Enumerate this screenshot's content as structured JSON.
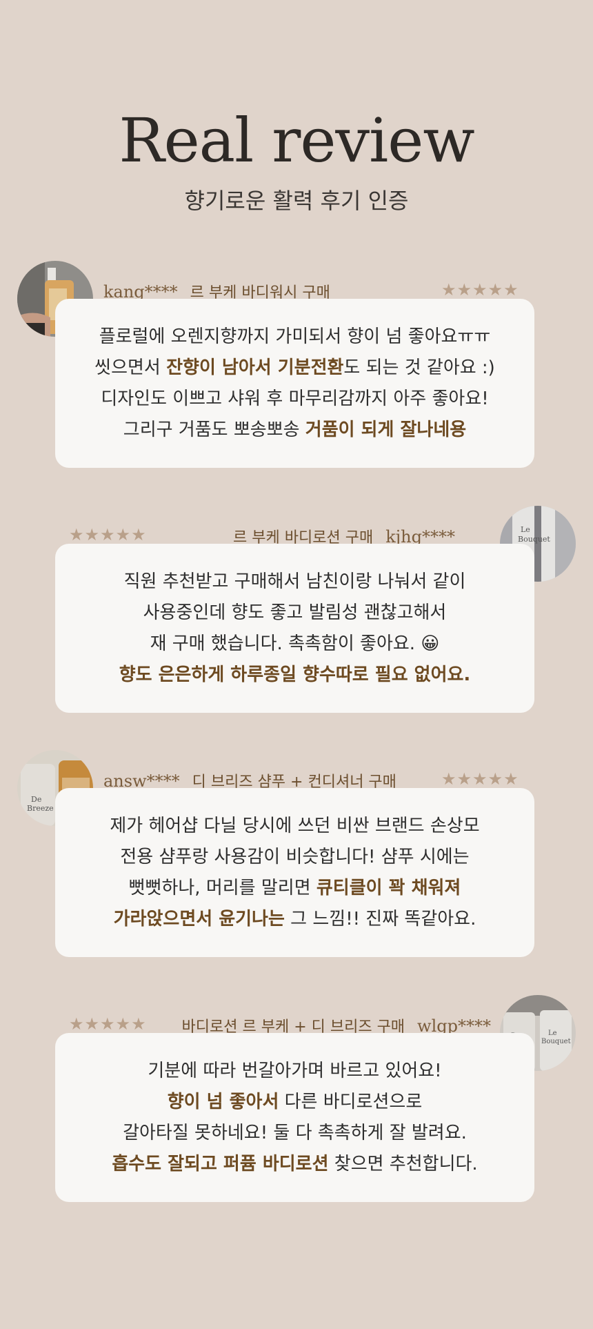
{
  "hero": {
    "title": "Real review",
    "subtitle": "향기로운 활력 후기 인증"
  },
  "rating_symbol": "★★★★★",
  "reviews": [
    {
      "user": "kang****",
      "product": "르 부케 바디워시 구매",
      "rating": 5,
      "avatar_icon": "body-wash-bottle-photo",
      "lines": [
        [
          {
            "t": "플로럴에 오렌지향까지 가미되서 향이 넘 좋아요ㅠㅠ",
            "h": false
          }
        ],
        [
          {
            "t": "씻으면서 ",
            "h": false
          },
          {
            "t": "잔향이 남아서 기분전환",
            "h": true
          },
          {
            "t": "도 되는 것 같아요 :)",
            "h": false
          }
        ],
        [
          {
            "t": "디자인도 이쁘고 샤워 후 마무리감까지 아주 좋아요!",
            "h": false
          }
        ],
        [
          {
            "t": "그리구 거품도 뽀송뽀송 ",
            "h": false
          },
          {
            "t": "거품이 되게 잘나네용",
            "h": true
          }
        ]
      ]
    },
    {
      "user": "kjhg****",
      "product": "르 부케 바디로션 구매",
      "rating": 5,
      "avatar_icon": "body-lotion-bottle-photo",
      "lines": [
        [
          {
            "t": "직원 추천받고 구매해서  남친이랑 나눠서 같이",
            "h": false
          }
        ],
        [
          {
            "t": "사용중인데 향도 좋고 발림성 괜찮고해서",
            "h": false
          }
        ],
        [
          {
            "t": "재 구매 했습니다. 촉촉함이 좋아요. 😀",
            "h": false
          }
        ],
        [
          {
            "t": "향도 은은하게 하루종일 향수따로 필요 없어요.",
            "h": true
          }
        ]
      ]
    },
    {
      "user": "answ****",
      "product": "디 브리즈 샴푸 + 컨디셔너 구매",
      "rating": 5,
      "avatar_icon": "shampoo-bottles-photo",
      "lines": [
        [
          {
            "t": "제가 헤어샵 다닐 당시에 쓰던 비싼 브랜드 손상모",
            "h": false
          }
        ],
        [
          {
            "t": "전용 샴푸랑 사용감이 비슷합니다! 샴푸 시에는",
            "h": false
          }
        ],
        [
          {
            "t": "뻣뻣하나, 머리를 말리면 ",
            "h": false
          },
          {
            "t": "큐티클이 꽉 채워져",
            "h": true
          }
        ],
        [
          {
            "t": "가라앉으면서 윤기나는",
            "h": true
          },
          {
            "t": " 그 느낌!! 진짜 똑같아요.",
            "h": false
          }
        ]
      ]
    },
    {
      "user": "wlgp****",
      "product": "바디로션 르 부케 + 디 브리즈 구매",
      "rating": 5,
      "avatar_icon": "lotion-bottles-photo",
      "lines": [
        [
          {
            "t": "기분에 따라 번갈아가며 바르고 있어요!",
            "h": false
          }
        ],
        [
          {
            "t": "향이 넘 좋아서",
            "h": true
          },
          {
            "t": " 다른 바디로션으로",
            "h": false
          }
        ],
        [
          {
            "t": "갈아타질 못하네요! 둘 다 촉촉하게 잘 발려요.",
            "h": false
          }
        ],
        [
          {
            "t": "흡수도 잘되고 퍼퓸 바디로션",
            "h": true
          },
          {
            "t": " 찾으면 추천합니다.",
            "h": false
          }
        ]
      ]
    }
  ],
  "colors": {
    "background": "#e0d4cb",
    "card": "#f8f7f5",
    "accent": "#6d4a21",
    "stars": "#b9a08a"
  }
}
